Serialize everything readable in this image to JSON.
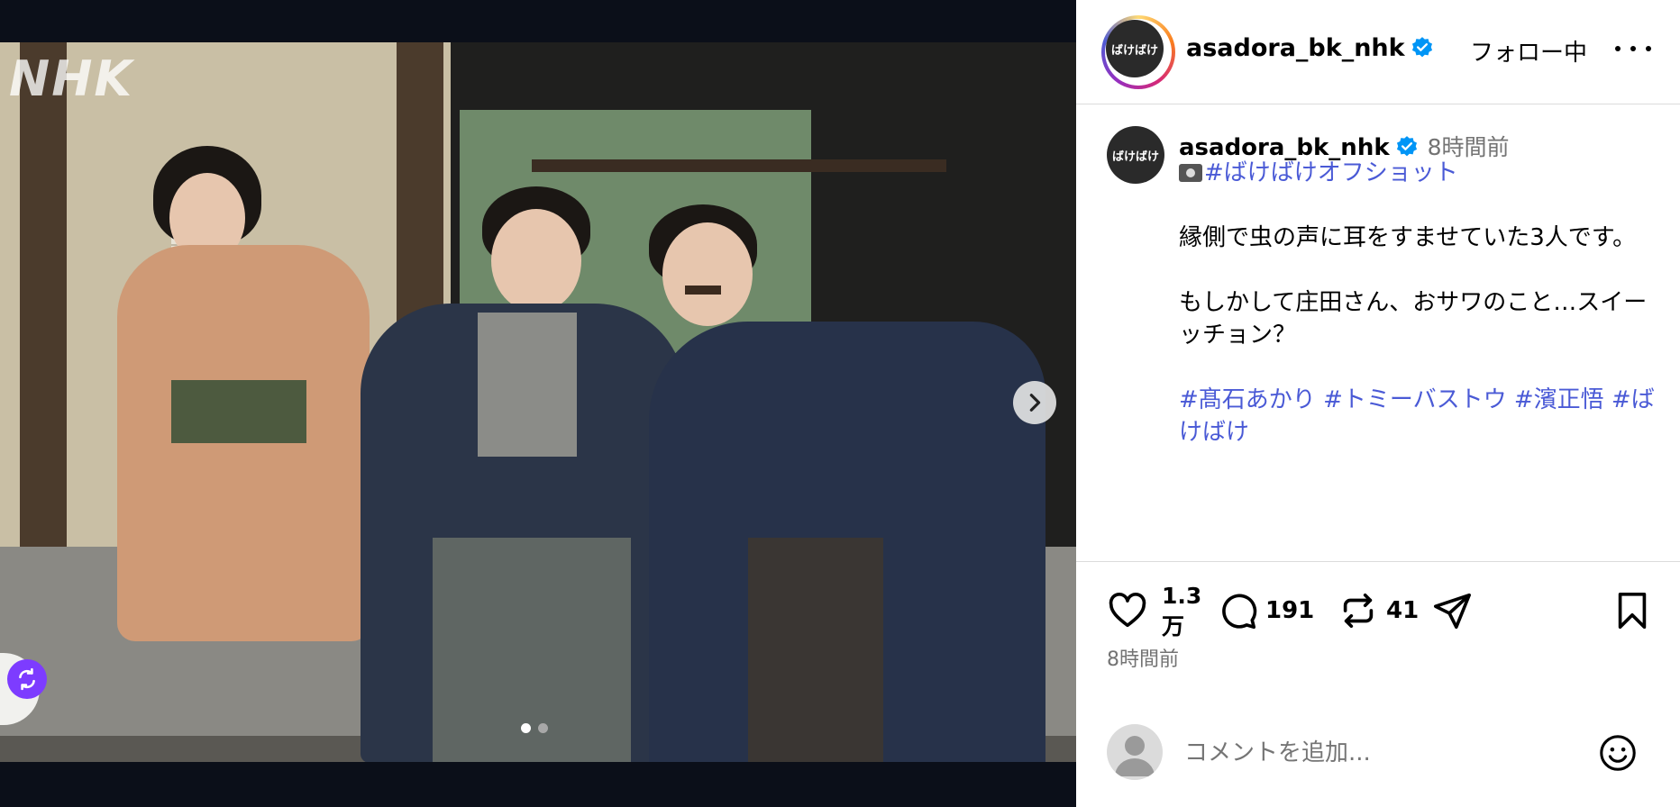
{
  "media": {
    "logo_text": "NHK",
    "carousel": {
      "current": 1,
      "total": 2
    }
  },
  "header": {
    "username": "asadora_bk_nhk",
    "avatar_text": "ばけばけ",
    "follow_label": "フォロー中"
  },
  "caption": {
    "username": "asadora_bk_nhk",
    "time": "8時間前",
    "hashtag_line": "#ばけばけオフショット",
    "paragraph1": "縁側で虫の声に耳をすませていた3人です。",
    "paragraph2": "もしかして庄田さん、おサワのこと…スイーッチョン？",
    "tags": [
      "#髙石あかり",
      "#トミーバストウ",
      "#濱正悟",
      "#ばけばけ"
    ]
  },
  "actions": {
    "likes": "1.3万",
    "likes_line1": "1.3",
    "likes_line2": "万",
    "comments": "191",
    "reposts": "41",
    "time": "8時間前"
  },
  "comment_box": {
    "placeholder": "コメントを追加..."
  },
  "icons": {
    "like": "heart-icon",
    "comment": "comment-icon",
    "repost": "repost-icon",
    "share": "send-icon",
    "save": "bookmark-icon",
    "next": "chevron-right-icon",
    "more": "more-horizontal-icon",
    "emoji": "emoji-icon",
    "verified": "verified-badge-icon"
  },
  "colors": {
    "hashtag": "#4a5ad6",
    "verified": "#0095f6",
    "muted": "#737373",
    "media_bg": "#0b0f19"
  }
}
